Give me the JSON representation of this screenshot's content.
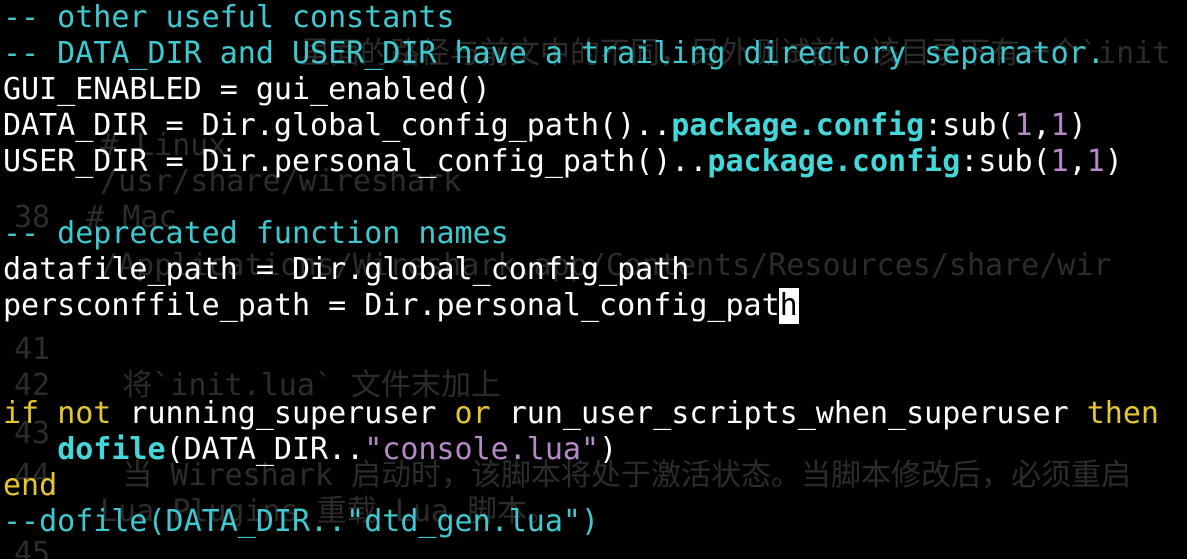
{
  "editor": {
    "lines": [
      {
        "parts": [
          {
            "t": "-- other useful constants",
            "c": "c-comment"
          }
        ]
      },
      {
        "parts": [
          {
            "t": "-- DATA_DIR and USER_DIR have a trailing directory separator.",
            "c": "c-comment"
          }
        ]
      },
      {
        "parts": [
          {
            "t": "GUI_ENABLED = gui_enabled()",
            "c": "c-ident"
          }
        ]
      },
      {
        "parts": [
          {
            "t": "DATA_DIR = Dir.global_config_path()..",
            "c": "c-ident"
          },
          {
            "t": "package.config",
            "c": "c-field"
          },
          {
            "t": ":sub(",
            "c": "c-ident"
          },
          {
            "t": "1",
            "c": "c-num"
          },
          {
            "t": ",",
            "c": "c-ident"
          },
          {
            "t": "1",
            "c": "c-num"
          },
          {
            "t": ")",
            "c": "c-ident"
          }
        ]
      },
      {
        "parts": [
          {
            "t": "USER_DIR = Dir.personal_config_path()..",
            "c": "c-ident"
          },
          {
            "t": "package.config",
            "c": "c-field"
          },
          {
            "t": ":sub(",
            "c": "c-ident"
          },
          {
            "t": "1",
            "c": "c-num"
          },
          {
            "t": ",",
            "c": "c-ident"
          },
          {
            "t": "1",
            "c": "c-num"
          },
          {
            "t": ")",
            "c": "c-ident"
          }
        ]
      },
      {
        "parts": []
      },
      {
        "parts": [
          {
            "t": "-- deprecated function names",
            "c": "c-comment"
          }
        ]
      },
      {
        "parts": [
          {
            "t": "datafile_path = Dir.global_config_path",
            "c": "c-ident"
          }
        ]
      },
      {
        "parts": [
          {
            "t": "persconffile_path = Dir.personal_config_pat",
            "c": "c-ident"
          },
          {
            "t": "h",
            "c": "cursor"
          }
        ]
      },
      {
        "parts": []
      },
      {
        "parts": []
      },
      {
        "parts": [
          {
            "t": "if",
            "c": "c-kw"
          },
          {
            "t": " ",
            "c": "c-ident"
          },
          {
            "t": "not",
            "c": "c-kw"
          },
          {
            "t": " running_superuser ",
            "c": "c-ident"
          },
          {
            "t": "or",
            "c": "c-kw"
          },
          {
            "t": " run_user_scripts_when_superuser ",
            "c": "c-ident"
          },
          {
            "t": "then",
            "c": "c-kw"
          }
        ]
      },
      {
        "parts": [
          {
            "t": "   ",
            "c": "c-ident"
          },
          {
            "t": "dofile",
            "c": "c-func"
          },
          {
            "t": "(DATA_DIR..",
            "c": "c-ident"
          },
          {
            "t": "\"console.lua\"",
            "c": "c-str"
          },
          {
            "t": ")",
            "c": "c-ident"
          }
        ]
      },
      {
        "parts": [
          {
            "t": "end",
            "c": "c-kw"
          }
        ]
      },
      {
        "parts": [
          {
            "t": "--dofile(DATA_DIR..\"dtd_gen.lua\")",
            "c": "c-comment"
          }
        ]
      }
    ]
  },
  "background_window": {
    "fragments": [
      "里面的路径与前文中的不同，另外测试前，该目录下有一个`init",
      "# Linux",
      "/usr/share/wireshark",
      "38  # Mac",
      "/Applications/Wireshark.app/Contents/Resources/share/wir",
      "41",
      "42    将`init.lua` 文件末加上",
      "43",
      "44    当 Wireshark 启动时，该脚本将处于激活状态。当脚本修改后，必须重启",
      "Lua Plugins 重载 Lua 脚本。",
      "45"
    ]
  }
}
